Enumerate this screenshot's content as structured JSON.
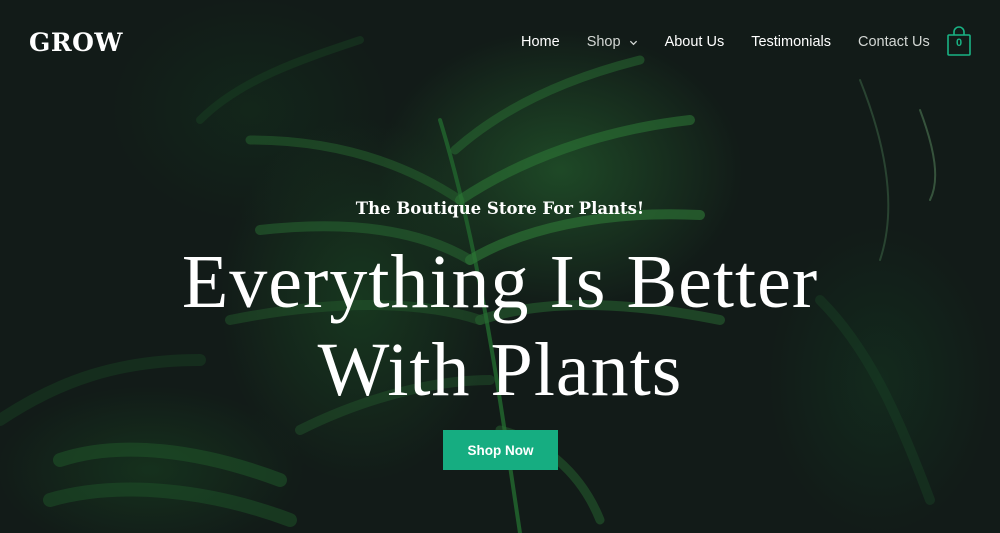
{
  "brand": {
    "logo_text": "GROW"
  },
  "nav": {
    "items": [
      {
        "label": "Home"
      },
      {
        "label": "Shop",
        "has_dropdown": true
      },
      {
        "label": "About Us"
      },
      {
        "label": "Testimonials"
      },
      {
        "label": "Contact Us"
      }
    ]
  },
  "cart": {
    "count": "0",
    "icon": "shopping-bag-icon"
  },
  "hero": {
    "tagline": "The Boutique Store For Plants!",
    "headline_line1": "Everything Is Better",
    "headline_line2": "With Plants",
    "cta_label": "Shop Now"
  },
  "colors": {
    "accent": "#16ad81",
    "cart_outline": "#19b384",
    "background": "#121b18",
    "text": "#ffffff"
  }
}
